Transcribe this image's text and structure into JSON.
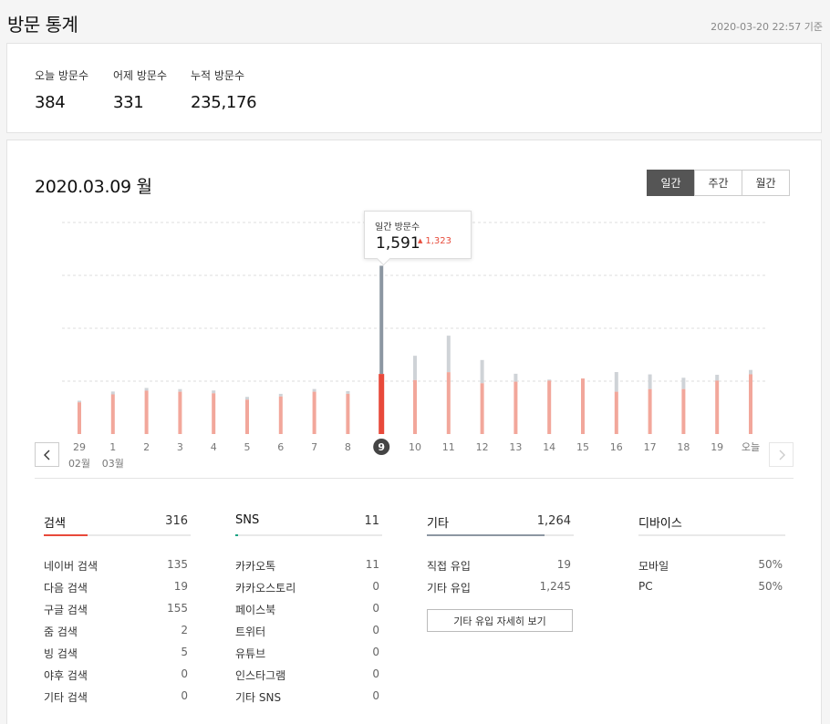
{
  "header": {
    "title": "방문 통계",
    "timestamp": "2020-03-20 22:57 기준"
  },
  "summary": {
    "today": {
      "label": "오늘 방문수",
      "value": "384"
    },
    "yesterday": {
      "label": "어제 방문수",
      "value": "331"
    },
    "total": {
      "label": "누적 방문수",
      "value": "235,176"
    }
  },
  "chart_header": {
    "date": "2020.03.09 월",
    "periods": [
      "일간",
      "주간",
      "월간"
    ],
    "active_period": "일간"
  },
  "tooltip": {
    "label": "일간 방문수",
    "value": "1,591",
    "delta": "1,323",
    "delta_color": "#e74c3c"
  },
  "chart_data": {
    "type": "bar",
    "categories": [
      "29",
      "1",
      "2",
      "3",
      "4",
      "5",
      "6",
      "7",
      "8",
      "9",
      "10",
      "11",
      "12",
      "13",
      "14",
      "15",
      "16",
      "17",
      "18",
      "19",
      "오늘"
    ],
    "month_labels": [
      {
        "index": 0,
        "text": "02월"
      },
      {
        "index": 1,
        "text": "03월"
      }
    ],
    "selected_index": 9,
    "series": [
      {
        "values": [
          300,
          375,
          410,
          400,
          385,
          325,
          355,
          400,
          380,
          568,
          510,
          585,
          480,
          495,
          505,
          525,
          400,
          425,
          425,
          505,
          565
        ]
      },
      {
        "values": [
          315,
          402,
          436,
          425,
          412,
          351,
          380,
          426,
          406,
          1591,
          740,
          930,
          700,
          570,
          515,
          526,
          586,
          564,
          532,
          560,
          606
        ]
      }
    ],
    "ylim": [
      0,
      2000
    ],
    "grid": true,
    "colors": {
      "primary": "#f2a79b",
      "secondary": "#cfd3d7",
      "selected_primary": "#e8493a",
      "selected_secondary": "#8c97a2",
      "grid": "#dedede",
      "label": "#777"
    }
  },
  "stats": {
    "search": {
      "title": "검색",
      "total": "316",
      "accent": "#e8493a",
      "fill": 0.3,
      "rows": [
        {
          "label": "네이버 검색",
          "value": "135"
        },
        {
          "label": "다음 검색",
          "value": "19"
        },
        {
          "label": "구글 검색",
          "value": "155"
        },
        {
          "label": "줌 검색",
          "value": "2"
        },
        {
          "label": "빙 검색",
          "value": "5"
        },
        {
          "label": "야후 검색",
          "value": "0"
        },
        {
          "label": "기타 검색",
          "value": "0"
        }
      ]
    },
    "sns": {
      "title": "SNS",
      "total": "11",
      "accent": "#1aa383",
      "fill": 0.02,
      "rows": [
        {
          "label": "카카오톡",
          "value": "11"
        },
        {
          "label": "카카오스토리",
          "value": "0"
        },
        {
          "label": "페이스북",
          "value": "0"
        },
        {
          "label": "트위터",
          "value": "0"
        },
        {
          "label": "유튜브",
          "value": "0"
        },
        {
          "label": "인스타그램",
          "value": "0"
        },
        {
          "label": "기타 SNS",
          "value": "0"
        }
      ]
    },
    "other": {
      "title": "기타",
      "total": "1,264",
      "accent": "#8c97a2",
      "fill": 0.8,
      "rows": [
        {
          "label": "직접 유입",
          "value": "19"
        },
        {
          "label": "기타 유입",
          "value": "1,245"
        }
      ],
      "detail_button": "기타 유입 자세히 보기"
    },
    "device": {
      "title": "디바이스",
      "rows": [
        {
          "label": "모바일",
          "value": "50%"
        },
        {
          "label": "PC",
          "value": "50%"
        }
      ]
    }
  }
}
